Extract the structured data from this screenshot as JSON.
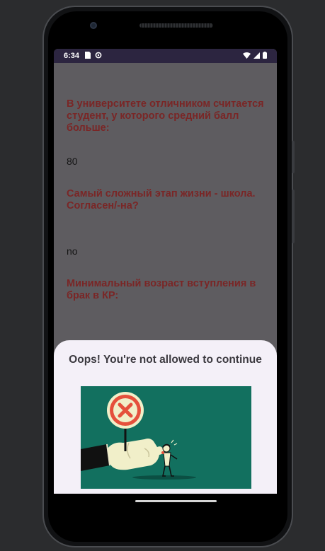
{
  "status_bar": {
    "time": "6:34",
    "icons_left": [
      "sim-card-icon",
      "settings-gear-icon"
    ],
    "icons_right": [
      "wifi-icon",
      "cellular-signal-icon",
      "battery-icon"
    ]
  },
  "quiz": {
    "items": [
      {
        "question": "В университете отличником считается студент, у которого средний балл больше:",
        "answer": "80"
      },
      {
        "question": "Самый сложный этап жизни - школа. Согласен/-на?",
        "answer": "no"
      },
      {
        "question": "Минимальный возраст вступления в брак в КР:",
        "answer": ""
      }
    ]
  },
  "dialog": {
    "title": "Oops! You're not allowed to continue",
    "illustration": "hand-holding-stop-sign-illustration"
  },
  "colors": {
    "question_text": "#7a2626",
    "dialog_background": "#f4f0f8",
    "illustration_background": "#12705f",
    "status_bar": "#2c2540"
  }
}
